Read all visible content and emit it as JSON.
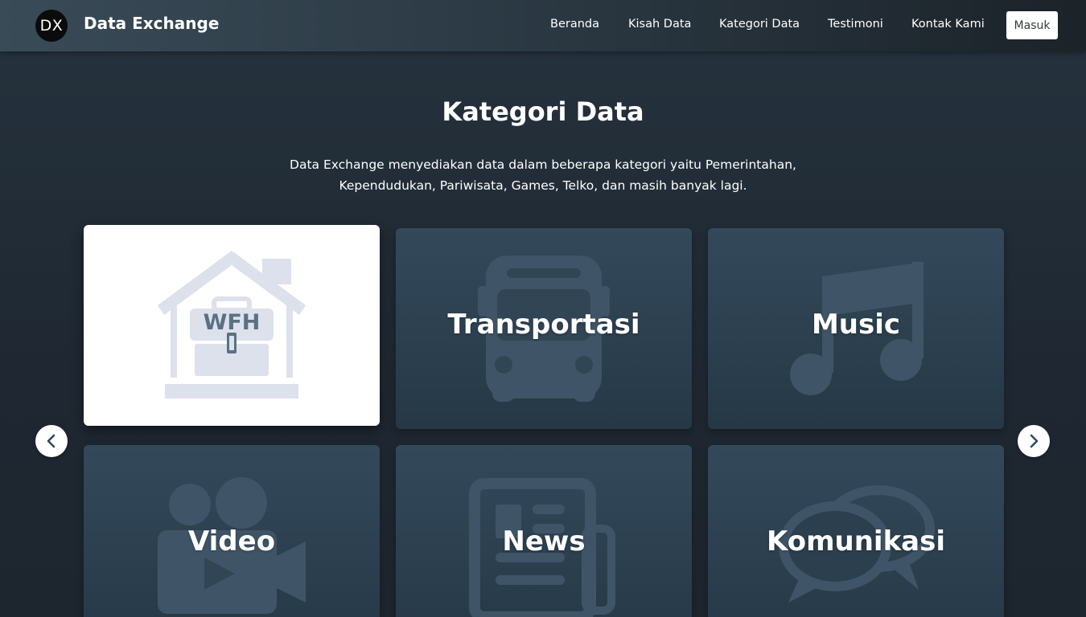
{
  "header": {
    "logo_text": "DX",
    "brand": "Data Exchange",
    "nav": [
      "Beranda",
      "Kisah Data",
      "Kategori Data",
      "Testimoni",
      "Kontak Kami"
    ],
    "login_label": "Masuk"
  },
  "section": {
    "title": "Kategori Data",
    "description": "Data Exchange menyediakan data dalam beberapa kategori yaitu Pemerintahan, Kependudukan, Pariwisata, Games, Telko, dan masih banyak lagi."
  },
  "cards": [
    {
      "label": "WFH",
      "icon": "house-briefcase-icon",
      "active": true
    },
    {
      "label": "Transportasi",
      "icon": "bus-icon"
    },
    {
      "label": "Music",
      "icon": "music-note-icon"
    },
    {
      "label": "Video",
      "icon": "video-camera-icon"
    },
    {
      "label": "News",
      "icon": "newspaper-icon"
    },
    {
      "label": "Komunikasi",
      "icon": "chat-bubbles-icon"
    }
  ],
  "carousel": {
    "prev_icon": "chevron-left-icon",
    "next_icon": "chevron-right-icon"
  },
  "colors": {
    "background": "#1f2832",
    "card": "#2e4252",
    "card_active": "#ffffff",
    "icon_watermark": "#3f5567",
    "wfh_icon": "#dde1ec",
    "wfh_text": "#5a7184",
    "arrow": "#2d4a62"
  }
}
